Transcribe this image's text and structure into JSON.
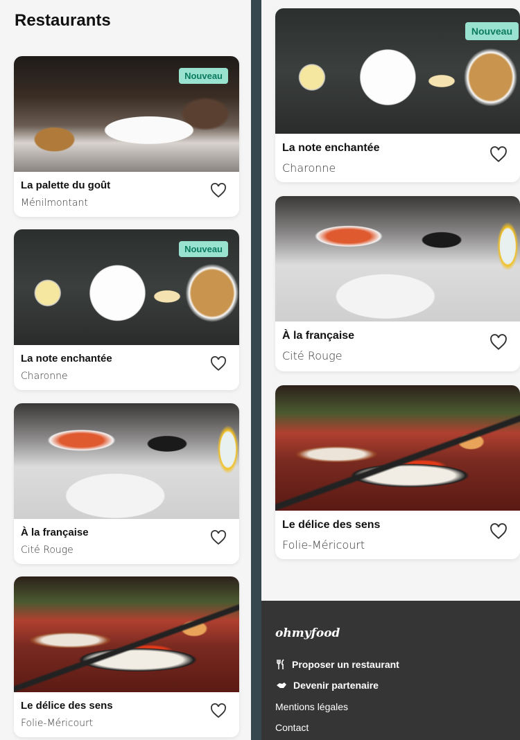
{
  "page_title": "Restaurants",
  "badge_label": "Nouveau",
  "left_cards": [
    {
      "name": "La palette du goût",
      "area": "Ménilmontant",
      "new": true
    },
    {
      "name": "La note enchantée",
      "area": "Charonne",
      "new": true
    },
    {
      "name": "À la française",
      "area": "Cité Rouge",
      "new": false
    },
    {
      "name": "Le délice des sens",
      "area": "Folie-Méricourt",
      "new": false
    }
  ],
  "right_cards": [
    {
      "name": "La note enchantée",
      "area": "Charonne",
      "new": true
    },
    {
      "name": "À la française",
      "area": "Cité Rouge",
      "new": false
    },
    {
      "name": "Le délice des sens",
      "area": "Folie-Méricourt",
      "new": false
    }
  ],
  "footer": {
    "logo": "ohmyfood",
    "propose": "Proposer un restaurant",
    "partner": "Devenir partenaire",
    "legal": "Mentions légales",
    "contact": "Contact"
  },
  "icons": {
    "heart": "heart-outline-icon",
    "utensils": "utensils-icon",
    "handshake": "handshake-icon"
  },
  "colors": {
    "badge_bg": "#99e2d0",
    "badge_text": "#0b7a5f",
    "footer_bg": "#353535",
    "divider": "#37474f"
  }
}
